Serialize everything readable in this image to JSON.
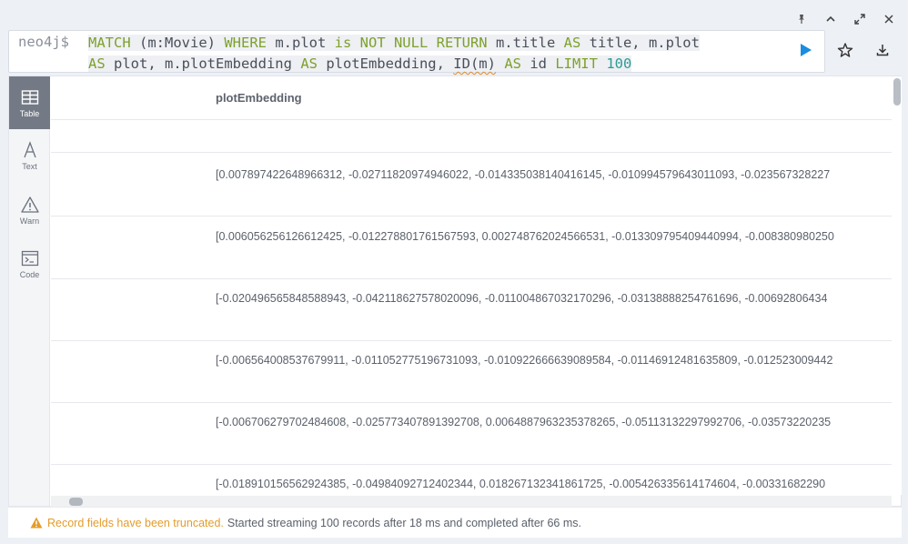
{
  "window_controls": {
    "pin": "pin-icon",
    "collapse": "chevron-up-icon",
    "expand": "expand-icon",
    "close": "close-icon"
  },
  "editor": {
    "prompt": "neo4j$",
    "query_line1": {
      "t1": "MATCH",
      "t2": " (m:Movie) ",
      "t3": "WHERE",
      "t4": " m.plot ",
      "t5": "is NOT NULL RETURN",
      "t6": " m.title ",
      "t7": "AS",
      "t8": " title, m.plot"
    },
    "query_line2": {
      "t1": "AS",
      "t2": " plot, m.plotEmbedding ",
      "t3": "AS",
      "t4": " plotEmbedding, ",
      "t5": "ID(m)",
      "t6": " ",
      "t7": "AS",
      "t8": " id ",
      "t9": "LIMIT",
      "t10": " ",
      "t11": "100"
    },
    "run_icon": "play-icon",
    "favorite_icon": "star-icon",
    "download_icon": "download-icon"
  },
  "sidebar": {
    "items": [
      {
        "label": "Table",
        "icon": "table-icon"
      },
      {
        "label": "Text",
        "icon": "text-icon"
      },
      {
        "label": "Warn",
        "icon": "warning-icon"
      },
      {
        "label": "Code",
        "icon": "code-icon"
      }
    ]
  },
  "table": {
    "column_header": "plotEmbedding",
    "rows": [
      "",
      "[0.007897422648966312, -0.02711820974946022, -0.014335038140416145, -0.010994579643011093, -0.023567328227",
      "[0.006056256126612425, -0.012278801761567593, 0.002748762024566531, -0.013309795409440994, -0.008380980250",
      "[-0.020496565848588943, -0.042118627578020096, -0.011004867032170296, -0.03138888254761696, -0.00692806434",
      "[-0.006564008537679911, -0.011052775196731093, -0.010922666639089584, -0.01146912481635809, -0.012523009442",
      "[-0.006706279702484608, -0.025773407891392708, 0.0064887963235378265, -0.05113132297992706, -0.03573220235",
      "[-0.018910156562924385, -0.04984092712402344, 0.018267132341861725, -0.005426335614174604, -0.00331682290"
    ]
  },
  "status": {
    "warning_icon": "warning-icon",
    "warning": "Record fields have been truncated.",
    "message": "Started streaming 100 records after 18 ms and completed after 66 ms."
  },
  "colors": {
    "keyword": "#7fa02b",
    "number": "#2d9b94",
    "run": "#1a8de0",
    "warning": "#e49c2a",
    "active_tab": "#747a85"
  }
}
